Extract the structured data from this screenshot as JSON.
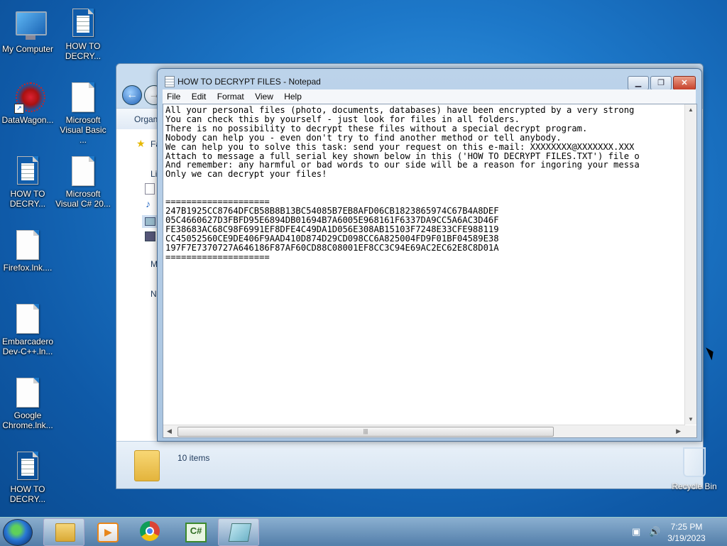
{
  "desktop": {
    "icons": [
      {
        "label": "My Computer"
      },
      {
        "label": "HOW TO DECRY..."
      },
      {
        "label": "DataWagon..."
      },
      {
        "label": "Microsoft Visual Basic ..."
      },
      {
        "label": "HOW TO DECRY..."
      },
      {
        "label": "Microsoft Visual C# 20..."
      },
      {
        "label": "Firefox.lnk...."
      },
      {
        "label": "Embarcadero Dev-C++.ln..."
      },
      {
        "label": "Google Chrome.lnk..."
      },
      {
        "label": "HOW TO DECRY..."
      },
      {
        "label": "Recycle Bin"
      }
    ]
  },
  "explorer": {
    "toolbar_label": "Organ",
    "sidebar": [
      "Fa",
      "Li",
      "M",
      "N"
    ],
    "status": "10 items"
  },
  "notepad": {
    "title": "HOW TO DECRYPT FILES - Notepad",
    "menu": [
      "File",
      "Edit",
      "Format",
      "View",
      "Help"
    ],
    "lines": [
      "All your personal files (photo, documents, databases) have been encrypted by a very strong",
      "You can check this by yourself - just look for files in all folders.",
      "There is no possibility to decrypt these files without a special decrypt program.",
      "Nobody can help you - even don't try to find another method or tell anybody.",
      "We can help you to solve this task: send your request on this e-mail: XXXXXXXX@XXXXXXX.XXX",
      "Attach to message a full serial key shown below in this ('HOW TO DECRYPT FILES.TXT') file o",
      "And remember: any harmful or bad words to our side will be a reason for ingoring your messa",
      "Only we can decrypt your files!",
      "",
      "",
      "====================",
      "247B1925CC8764DFCB58B8B13BC54085B7EB8AFD06CB1823865974C67B4A8DEF",
      "05C4660627D3FBFD95E6894DB01694B7A6005E968161F6337DA9CC5A6AC3D46F",
      "FE38683AC68C98F6991EF8DFE4C49DA1D056E308AB15103F7248E33CFE988119",
      "CC45052560CE9DE406F9AAD410D874D29CD098CC6A825004FD9F01BF04589E38",
      "197F7E7370727A646186F87AF60CD88C08001EF8CC3C94E69AC2EC62E8C8D01A",
      "===================="
    ]
  },
  "taskbar": {
    "time": "7:25 PM",
    "date": "3/19/2023"
  },
  "colors": {
    "accent": "#1d78c9",
    "title_bar": "#bcd3ea"
  }
}
